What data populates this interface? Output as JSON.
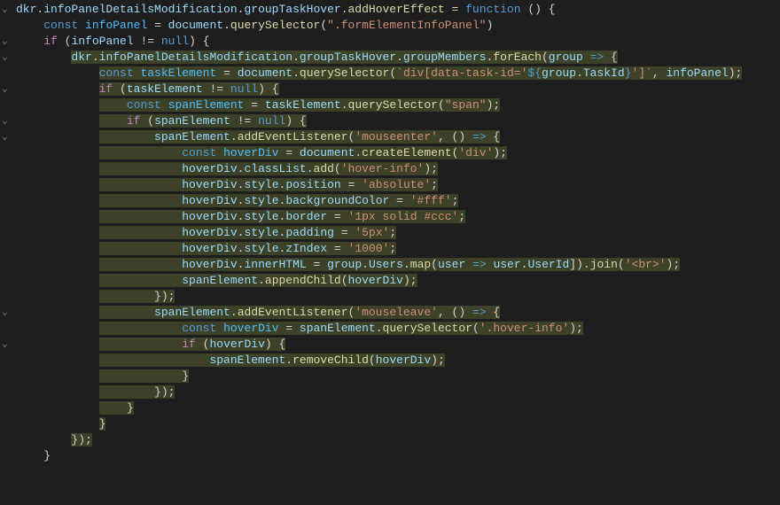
{
  "tokens": [
    {
      "indent": 0,
      "fold": "open",
      "parts": [
        [
          "var",
          "dkr"
        ],
        [
          "punct",
          "."
        ],
        [
          "var",
          "infoPanelDetailsModification"
        ],
        [
          "punct",
          "."
        ],
        [
          "var",
          "groupTaskHover"
        ],
        [
          "punct",
          "."
        ],
        [
          "func",
          "addHoverEffect"
        ],
        [
          "punct",
          " = "
        ],
        [
          "kw",
          "function"
        ],
        [
          "punct",
          " () {"
        ]
      ]
    },
    {
      "indent": 1,
      "fold": "",
      "parts": [
        [
          "kw",
          "const"
        ],
        [
          "punct",
          " "
        ],
        [
          "const-var",
          "infoPanel"
        ],
        [
          "punct",
          " = "
        ],
        [
          "var",
          "document"
        ],
        [
          "punct",
          "."
        ],
        [
          "func",
          "querySelector"
        ],
        [
          "punct",
          "("
        ],
        [
          "str",
          "\".formElementInfoPanel\""
        ],
        [
          "punct",
          ")"
        ]
      ]
    },
    {
      "indent": 1,
      "fold": "open",
      "parts": [
        [
          "kw2",
          "if"
        ],
        [
          "punct",
          " ("
        ],
        [
          "var",
          "infoPanel"
        ],
        [
          "punct",
          " != "
        ],
        [
          "kw",
          "null"
        ],
        [
          "punct",
          ") {"
        ]
      ]
    },
    {
      "indent": 2,
      "fold": "open",
      "parts": [
        [
          "var",
          "dkr"
        ],
        [
          "punct",
          "."
        ],
        [
          "var",
          "infoPanelDetailsModification"
        ],
        [
          "punct",
          "."
        ],
        [
          "var",
          "groupTaskHover"
        ],
        [
          "punct",
          "."
        ],
        [
          "var",
          "groupMembers"
        ],
        [
          "punct",
          "."
        ],
        [
          "func",
          "forEach"
        ],
        [
          "punct",
          "("
        ],
        [
          "var",
          "group"
        ],
        [
          "punct",
          " "
        ],
        [
          "kw",
          "=>"
        ],
        [
          "punct",
          " {"
        ]
      ]
    },
    {
      "indent": 3,
      "fold": "",
      "parts": [
        [
          "kw",
          "const"
        ],
        [
          "punct",
          " "
        ],
        [
          "const-var",
          "taskElement"
        ],
        [
          "punct",
          " = "
        ],
        [
          "var",
          "document"
        ],
        [
          "punct",
          "."
        ],
        [
          "func",
          "querySelector"
        ],
        [
          "punct",
          "("
        ],
        [
          "tmpl",
          "`div[data-task-id='"
        ],
        [
          "tmpl-expr",
          "${"
        ],
        [
          "var",
          "group"
        ],
        [
          "punct",
          "."
        ],
        [
          "var",
          "TaskId"
        ],
        [
          "tmpl-expr",
          "}"
        ],
        [
          "tmpl",
          "']`"
        ],
        [
          "punct",
          ", "
        ],
        [
          "var",
          "infoPanel"
        ],
        [
          "punct",
          ");"
        ]
      ]
    },
    {
      "indent": 3,
      "fold": "open",
      "parts": [
        [
          "kw2",
          "if"
        ],
        [
          "punct",
          " ("
        ],
        [
          "var",
          "taskElement"
        ],
        [
          "punct",
          " != "
        ],
        [
          "kw",
          "null"
        ],
        [
          "punct",
          ") {"
        ]
      ]
    },
    {
      "indent": 4,
      "fold": "",
      "parts": [
        [
          "kw",
          "const"
        ],
        [
          "punct",
          " "
        ],
        [
          "const-var",
          "spanElement"
        ],
        [
          "punct",
          " = "
        ],
        [
          "var",
          "taskElement"
        ],
        [
          "punct",
          "."
        ],
        [
          "func",
          "querySelector"
        ],
        [
          "punct",
          "("
        ],
        [
          "str",
          "\"span\""
        ],
        [
          "punct",
          ");"
        ]
      ]
    },
    {
      "indent": 4,
      "fold": "open",
      "parts": [
        [
          "kw2",
          "if"
        ],
        [
          "punct",
          " ("
        ],
        [
          "var",
          "spanElement"
        ],
        [
          "punct",
          " != "
        ],
        [
          "kw",
          "null"
        ],
        [
          "punct",
          ") {"
        ]
      ]
    },
    {
      "indent": 5,
      "fold": "open",
      "parts": [
        [
          "var",
          "spanElement"
        ],
        [
          "punct",
          "."
        ],
        [
          "func",
          "addEventListener"
        ],
        [
          "punct",
          "("
        ],
        [
          "str",
          "'mouseenter'"
        ],
        [
          "punct",
          ", () "
        ],
        [
          "kw",
          "=>"
        ],
        [
          "punct",
          " {"
        ]
      ]
    },
    {
      "indent": 6,
      "fold": "",
      "parts": [
        [
          "kw",
          "const"
        ],
        [
          "punct",
          " "
        ],
        [
          "const-var",
          "hoverDiv"
        ],
        [
          "punct",
          " = "
        ],
        [
          "var",
          "document"
        ],
        [
          "punct",
          "."
        ],
        [
          "func",
          "createElement"
        ],
        [
          "punct",
          "("
        ],
        [
          "str",
          "'div'"
        ],
        [
          "punct",
          ");"
        ]
      ]
    },
    {
      "indent": 6,
      "fold": "",
      "parts": [
        [
          "var",
          "hoverDiv"
        ],
        [
          "punct",
          "."
        ],
        [
          "var",
          "classList"
        ],
        [
          "punct",
          "."
        ],
        [
          "func",
          "add"
        ],
        [
          "punct",
          "("
        ],
        [
          "str",
          "'hover-info'"
        ],
        [
          "punct",
          ");"
        ]
      ]
    },
    {
      "indent": 6,
      "fold": "",
      "parts": [
        [
          "var",
          "hoverDiv"
        ],
        [
          "punct",
          "."
        ],
        [
          "var",
          "style"
        ],
        [
          "punct",
          "."
        ],
        [
          "var",
          "position"
        ],
        [
          "punct",
          " = "
        ],
        [
          "str",
          "'absolute'"
        ],
        [
          "punct",
          ";"
        ]
      ]
    },
    {
      "indent": 6,
      "fold": "",
      "parts": [
        [
          "var",
          "hoverDiv"
        ],
        [
          "punct",
          "."
        ],
        [
          "var",
          "style"
        ],
        [
          "punct",
          "."
        ],
        [
          "var",
          "backgroundColor"
        ],
        [
          "punct",
          " = "
        ],
        [
          "str",
          "'#fff'"
        ],
        [
          "punct",
          ";"
        ]
      ]
    },
    {
      "indent": 6,
      "fold": "",
      "parts": [
        [
          "var",
          "hoverDiv"
        ],
        [
          "punct",
          "."
        ],
        [
          "var",
          "style"
        ],
        [
          "punct",
          "."
        ],
        [
          "var",
          "border"
        ],
        [
          "punct",
          " = "
        ],
        [
          "str",
          "'1px solid #ccc'"
        ],
        [
          "punct",
          ";"
        ]
      ]
    },
    {
      "indent": 6,
      "fold": "",
      "parts": [
        [
          "var",
          "hoverDiv"
        ],
        [
          "punct",
          "."
        ],
        [
          "var",
          "style"
        ],
        [
          "punct",
          "."
        ],
        [
          "var",
          "padding"
        ],
        [
          "punct",
          " = "
        ],
        [
          "str",
          "'5px'"
        ],
        [
          "punct",
          ";"
        ]
      ]
    },
    {
      "indent": 6,
      "fold": "",
      "parts": [
        [
          "var",
          "hoverDiv"
        ],
        [
          "punct",
          "."
        ],
        [
          "var",
          "style"
        ],
        [
          "punct",
          "."
        ],
        [
          "var",
          "zIndex"
        ],
        [
          "punct",
          " = "
        ],
        [
          "str",
          "'1000'"
        ],
        [
          "punct",
          ";"
        ]
      ]
    },
    {
      "indent": 6,
      "fold": "",
      "parts": [
        [
          "var",
          "hoverDiv"
        ],
        [
          "punct",
          "."
        ],
        [
          "var",
          "innerHTML"
        ],
        [
          "punct",
          " = "
        ],
        [
          "var",
          "group"
        ],
        [
          "punct",
          "."
        ],
        [
          "var",
          "Users"
        ],
        [
          "punct",
          "."
        ],
        [
          "func",
          "map"
        ],
        [
          "punct",
          "("
        ],
        [
          "var",
          "user"
        ],
        [
          "punct",
          " "
        ],
        [
          "kw",
          "=>"
        ],
        [
          "punct",
          " "
        ],
        [
          "var",
          "user"
        ],
        [
          "punct",
          "."
        ],
        [
          "var",
          "UserId"
        ],
        [
          "punct",
          "])."
        ],
        [
          "func",
          "join"
        ],
        [
          "punct",
          "("
        ],
        [
          "str",
          "'<br>'"
        ],
        [
          "punct",
          ");"
        ]
      ]
    },
    {
      "indent": 6,
      "fold": "",
      "parts": [
        [
          "var",
          "spanElement"
        ],
        [
          "punct",
          "."
        ],
        [
          "func",
          "appendChild"
        ],
        [
          "punct",
          "("
        ],
        [
          "var",
          "hoverDiv"
        ],
        [
          "punct",
          ");"
        ]
      ]
    },
    {
      "indent": 5,
      "fold": "",
      "parts": [
        [
          "punct",
          "});"
        ]
      ]
    },
    {
      "indent": 5,
      "fold": "open",
      "parts": [
        [
          "var",
          "spanElement"
        ],
        [
          "punct",
          "."
        ],
        [
          "func",
          "addEventListener"
        ],
        [
          "punct",
          "("
        ],
        [
          "str",
          "'mouseleave'"
        ],
        [
          "punct",
          ", () "
        ],
        [
          "kw",
          "=>"
        ],
        [
          "punct",
          " {"
        ]
      ]
    },
    {
      "indent": 6,
      "fold": "",
      "parts": [
        [
          "kw",
          "const"
        ],
        [
          "punct",
          " "
        ],
        [
          "const-var",
          "hoverDiv"
        ],
        [
          "punct",
          " = "
        ],
        [
          "var",
          "spanElement"
        ],
        [
          "punct",
          "."
        ],
        [
          "func",
          "querySelector"
        ],
        [
          "punct",
          "("
        ],
        [
          "str",
          "'.hover-info'"
        ],
        [
          "punct",
          ");"
        ]
      ]
    },
    {
      "indent": 6,
      "fold": "open",
      "parts": [
        [
          "kw2",
          "if"
        ],
        [
          "punct",
          " ("
        ],
        [
          "var",
          "hoverDiv"
        ],
        [
          "punct",
          ") {"
        ]
      ]
    },
    {
      "indent": 7,
      "fold": "",
      "parts": [
        [
          "var",
          "spanElement"
        ],
        [
          "punct",
          "."
        ],
        [
          "func",
          "removeChild"
        ],
        [
          "punct",
          "("
        ],
        [
          "var",
          "hoverDiv"
        ],
        [
          "punct",
          ");"
        ]
      ]
    },
    {
      "indent": 6,
      "fold": "",
      "parts": [
        [
          "punct",
          "}"
        ]
      ]
    },
    {
      "indent": 5,
      "fold": "",
      "parts": [
        [
          "punct",
          "});"
        ]
      ]
    },
    {
      "indent": 4,
      "fold": "",
      "parts": [
        [
          "punct",
          "}"
        ]
      ]
    },
    {
      "indent": 3,
      "fold": "",
      "parts": [
        [
          "punct",
          "}"
        ]
      ]
    },
    {
      "indent": 2,
      "fold": "",
      "parts": [
        [
          "punct",
          "});"
        ]
      ]
    },
    {
      "indent": 1,
      "fold": "",
      "parts": [
        [
          "punct",
          "}"
        ]
      ]
    }
  ],
  "highlight": {
    "start": 3,
    "end": 27,
    "depth": 3
  },
  "indent_size": 4
}
